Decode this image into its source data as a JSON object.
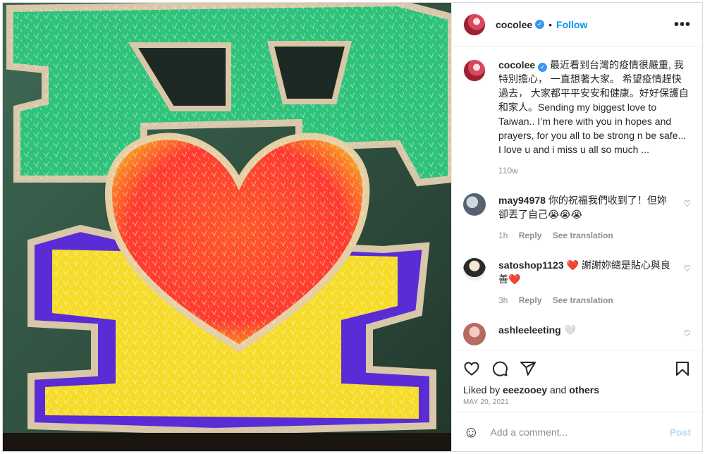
{
  "header": {
    "username": "cocolee",
    "dot": "•",
    "follow_label": "Follow",
    "more_label": "•••"
  },
  "caption": {
    "username": "cocolee",
    "text": "最近看到台灣的疫情很嚴重, 我特別擔心， 一直想著大家。 希望疫情趕快過去， 大家都平平安安和健康。好好保護自和家人。Sending my biggest love to Taiwan.. I’m here with you in hopes and prayers, for you all to be strong n be safe... I love u and i miss u all so much ...",
    "time": "110w"
  },
  "comments": [
    {
      "username": "may94978",
      "text": "你的祝福我們收到了！但妳卻丟了自己😭😭😭",
      "time": "1h",
      "reply_label": "Reply",
      "translate_label": "See translation"
    },
    {
      "username": "satoshop1123",
      "text": "❤️ 謝謝妳總是貼心與良善❤️",
      "time": "3h",
      "reply_label": "Reply",
      "translate_label": "See translation"
    },
    {
      "username": "ashleeleeting",
      "text": "🤍"
    }
  ],
  "likes": {
    "prefix": "Liked by",
    "user": "eeezooey",
    "and": "and",
    "others": "others"
  },
  "date": "MAY 20, 2021",
  "add_comment": {
    "emoji": "☺",
    "placeholder": "Add a comment...",
    "post_label": "Post"
  },
  "colors": {
    "accent": "#0095f6",
    "verified": "#3897f0",
    "post_disabled": "#b2dffc",
    "muted": "#8e8e8e"
  },
  "icons": [
    "verified-icon",
    "more-icon",
    "like-icon",
    "comment-icon",
    "share-icon",
    "save-icon",
    "emoji-icon",
    "heart-small-icon"
  ]
}
